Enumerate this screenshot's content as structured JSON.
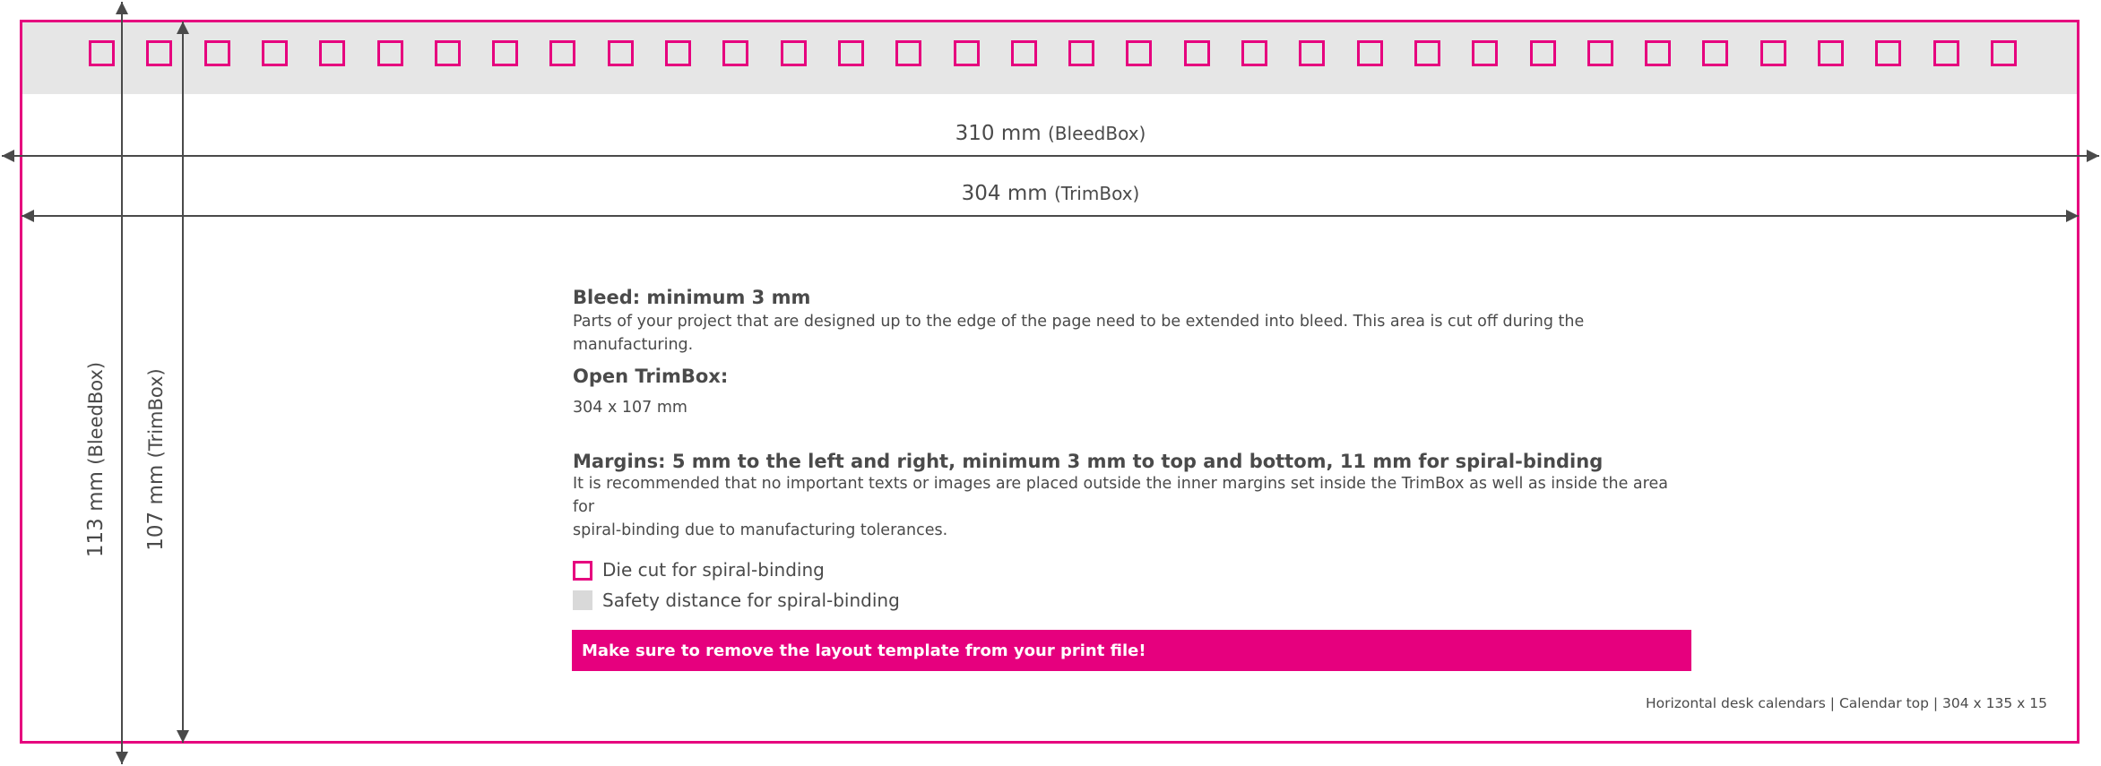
{
  "dimensions": {
    "bleed_width": {
      "value": "310 mm",
      "box": "(BleedBox)"
    },
    "trim_width": {
      "value": "304 mm",
      "box": "(TrimBox)"
    },
    "bleed_height": {
      "value": "113 mm",
      "box": "(BleedBox)"
    },
    "trim_height": {
      "value": "107 mm",
      "box": "(TrimBox)"
    }
  },
  "spiral_binding": {
    "hole_count": 34
  },
  "sections": {
    "bleed": {
      "heading": "Bleed: minimum 3 mm",
      "text": "Parts of your project that are designed up to the edge of the page need to be extended into bleed. This area is cut off during the manufacturing."
    },
    "open_trimbox": {
      "heading": "Open TrimBox:",
      "text": "304 x 107 mm"
    },
    "margins": {
      "heading": "Margins: 5 mm to the left and right, minimum 3 mm to top and bottom, 11 mm for spiral-binding",
      "text_line1": "It is recommended that no important texts or images are placed outside the inner margins set inside the TrimBox as well as inside the area for",
      "text_line2": "spiral-binding due to manufacturing tolerances."
    }
  },
  "legend": {
    "die_cut": "Die cut for spiral-binding",
    "safety": "Safety distance for spiral-binding"
  },
  "warning": "Make sure to remove the layout template from your print file!",
  "footer": "Horizontal desk calendars  |  Calendar top  |  304 x 135 x 15",
  "colors": {
    "accent": "#e6007e",
    "band": "#e6e6e6",
    "line": "#4a4a4a"
  }
}
